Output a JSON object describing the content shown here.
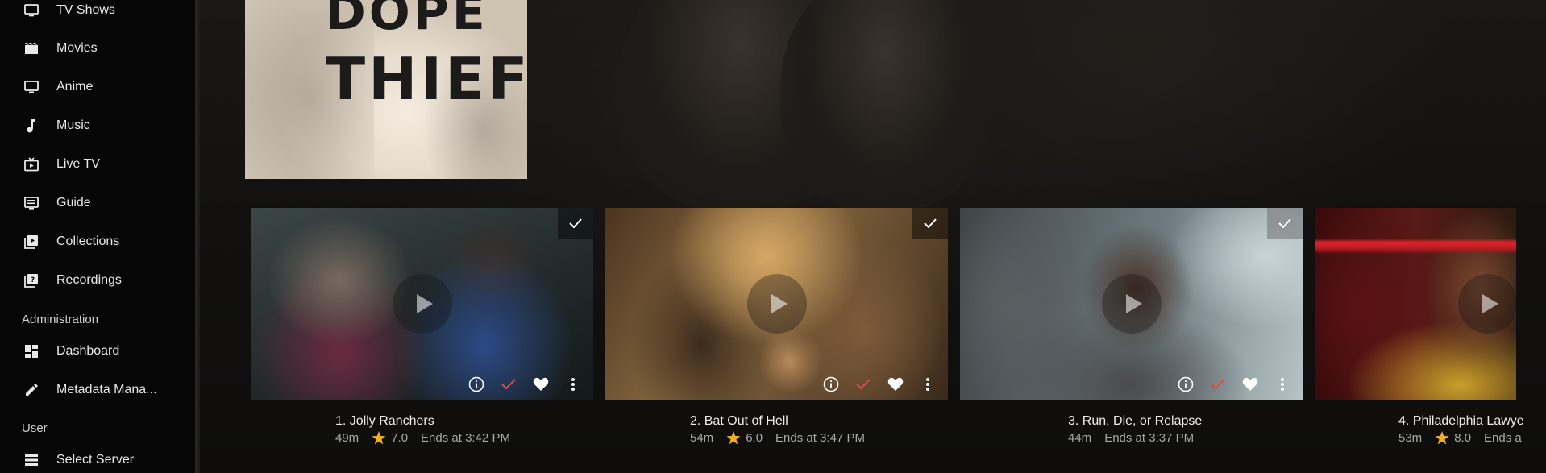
{
  "sidebar": {
    "items": [
      {
        "label": "TV Shows",
        "icon": "tv-icon"
      },
      {
        "label": "Movies",
        "icon": "movie-clapper-icon"
      },
      {
        "label": "Anime",
        "icon": "tv-icon"
      },
      {
        "label": "Music",
        "icon": "music-note-icon"
      },
      {
        "label": "Live TV",
        "icon": "live-tv-icon"
      },
      {
        "label": "Guide",
        "icon": "guide-icon"
      },
      {
        "label": "Collections",
        "icon": "collections-icon"
      },
      {
        "label": "Recordings",
        "icon": "recordings-icon"
      }
    ],
    "admin_header": "Administration",
    "admin_items": [
      {
        "label": "Dashboard",
        "icon": "dashboard-icon"
      },
      {
        "label": "Metadata Mana...",
        "icon": "pencil-icon"
      }
    ],
    "user_header": "User",
    "user_items": [
      {
        "label": "Select Server",
        "icon": "server-list-icon"
      }
    ]
  },
  "poster": {
    "title_line1": "DOPE",
    "title_line2": "THIEF"
  },
  "episodes": [
    {
      "title": "1. Jolly Ranchers",
      "runtime": "49m",
      "rating": "7.0",
      "ends": "Ends at 3:42 PM",
      "watched": true
    },
    {
      "title": "2. Bat Out of Hell",
      "runtime": "54m",
      "rating": "6.0",
      "ends": "Ends at 3:47 PM",
      "watched": true
    },
    {
      "title": "3. Run, Die, or Relapse",
      "runtime": "44m",
      "rating": "",
      "ends": "Ends at 3:37 PM",
      "watched": true
    },
    {
      "title": "4. Philadelphia Lawye",
      "runtime": "53m",
      "rating": "8.0",
      "ends": "Ends a",
      "watched": false
    }
  ],
  "colors": {
    "accent_red": "#e04a48",
    "star_gold": "#f2b01e",
    "sidebar_bg": "#060606"
  }
}
